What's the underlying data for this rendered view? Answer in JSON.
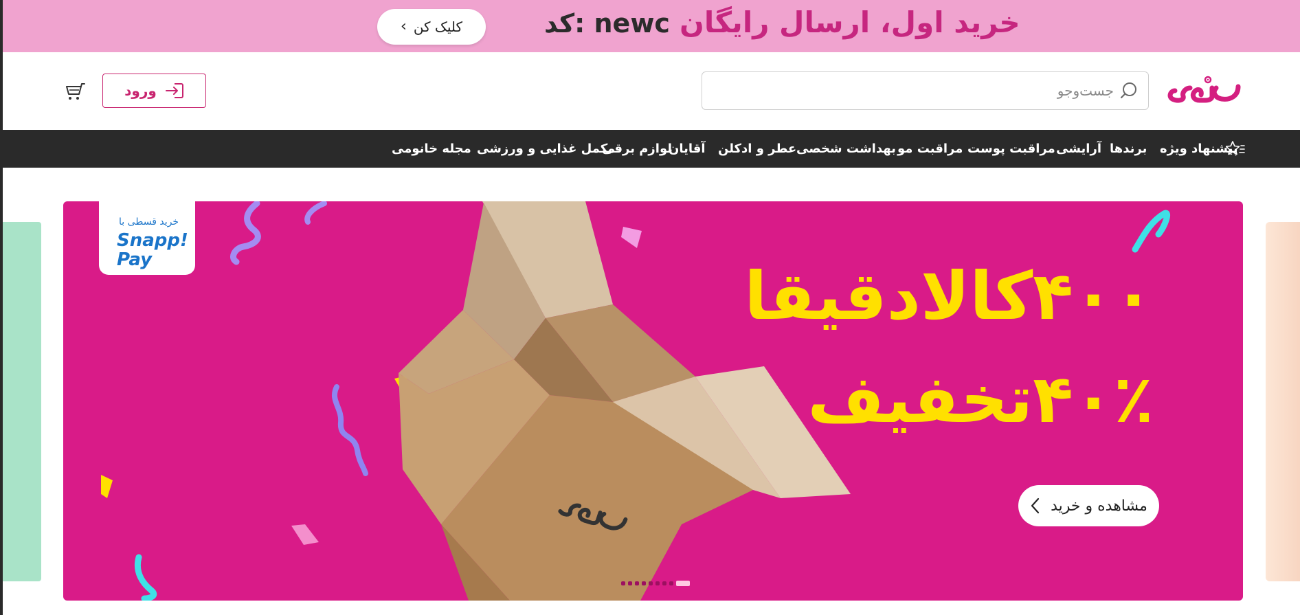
{
  "promo": {
    "text": "خرید اول، ارسال رایگان",
    "code_label": "کد: newc",
    "button_label": "کلیک کن"
  },
  "header": {
    "logo_alt": "خانومی",
    "search_placeholder": "جست‌وجو",
    "login_label": "ورود"
  },
  "nav": {
    "items": [
      "پیشنهاد ویژه",
      "برندها",
      "آرایشی",
      "مراقبت پوست",
      "مراقبت مو",
      "بهداشت شخصی",
      "عطر و ادکلن",
      "آقایان",
      "لوازم برقی",
      "مکمل غذایی و ورزشی",
      "مجله خانومی"
    ]
  },
  "hero": {
    "snapp_subtitle": "خرید قسطی با",
    "snapp_brand_line1": "Snapp!",
    "snapp_brand_line2": "Pay",
    "title_line1": "۴۰۰کالادقیقا",
    "title_line2": "۴۰٪تخفیف",
    "cta_label": "مشاهده و خرید",
    "slides_count": 9,
    "active_slide": 9
  },
  "colors": {
    "promo_bg": "#f0a3cf",
    "promo_text": "#c6267f",
    "brand": "#c8246f",
    "nav_bg": "#2a2a2a",
    "hero_bg": "#d91b88",
    "hero_title": "#ffe000"
  }
}
